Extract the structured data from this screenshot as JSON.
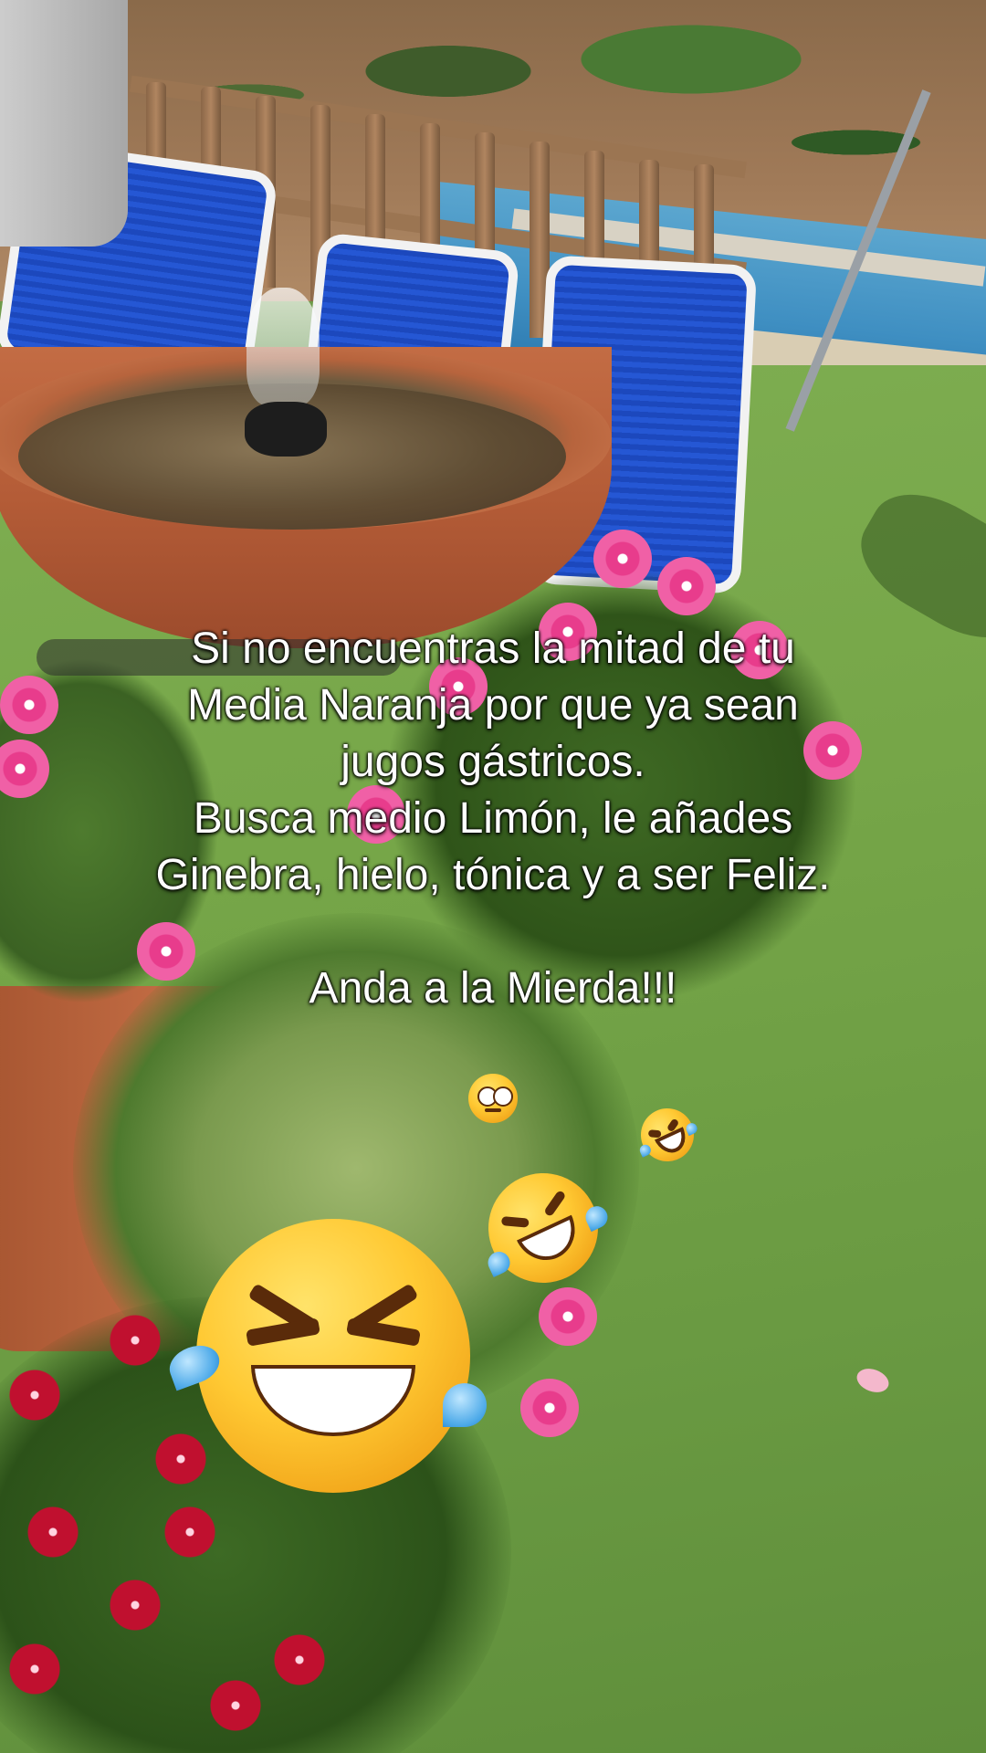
{
  "caption": {
    "lines": [
      "Si no encuentras la mitad de tu",
      "Media Naranja por que ya sean",
      "jugos gástricos.",
      "Busca medio Limón, le añades",
      "Ginebra, hielo, tónica y a ser Feliz.",
      "",
      "Anda a la Mierda!!!"
    ]
  },
  "emojis": [
    {
      "name": "face-with-rolling-eyes-icon",
      "glyph": "🙄"
    },
    {
      "name": "rolling-on-floor-laughing-icon",
      "glyph": "🤣"
    },
    {
      "name": "rolling-on-floor-laughing-icon",
      "glyph": "🤣"
    },
    {
      "name": "grinning-squinting-tears-icon",
      "glyph": "😆"
    }
  ],
  "colors": {
    "text": "#ffffff",
    "lawn": "#76a648",
    "pot": "#c06a42",
    "chair": "#1f4fc8"
  }
}
